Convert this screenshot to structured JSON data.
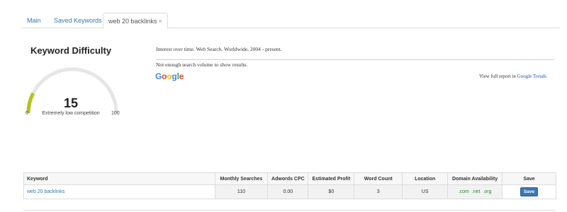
{
  "tabs": [
    {
      "label": "Main"
    },
    {
      "label": "Saved Keywords"
    },
    {
      "label": "web 20 backlinks",
      "close": "×"
    }
  ],
  "keyword_difficulty": {
    "title": "Keyword Difficulty",
    "value": "15",
    "level": 0.15,
    "label": "Extremely low competition",
    "min": "0",
    "max": "100",
    "colors": {
      "fill": "#b5c21a",
      "track": "#e6e6e6"
    }
  },
  "trends": {
    "title": "Interest over time. Web Search. Worldwide, 2004 - present.",
    "message": "Not enough search volume to show results.",
    "google_letters": [
      {
        "ch": "G",
        "color": "#4285f4"
      },
      {
        "ch": "o",
        "color": "#ea4335"
      },
      {
        "ch": "o",
        "color": "#fbbc05"
      },
      {
        "ch": "g",
        "color": "#4285f4"
      },
      {
        "ch": "l",
        "color": "#34a853"
      },
      {
        "ch": "e",
        "color": "#ea4335"
      }
    ],
    "full_report_prefix": "View full report in ",
    "full_report_link": "Google Trends"
  },
  "table": {
    "headers": [
      "Keyword",
      "Monthly Searches",
      "Adwords CPC",
      "Estimated Profit",
      "Word Count",
      "Location",
      "Domain Availability",
      "Save"
    ],
    "row": {
      "keyword": "web 20 backlinks",
      "monthly_searches": "110",
      "adwords_cpc": "0.00",
      "estimated_profit": "$0",
      "word_count": "3",
      "location": "US",
      "domains": [
        ".com",
        ".net",
        ".org"
      ],
      "save_label": "Save"
    }
  }
}
